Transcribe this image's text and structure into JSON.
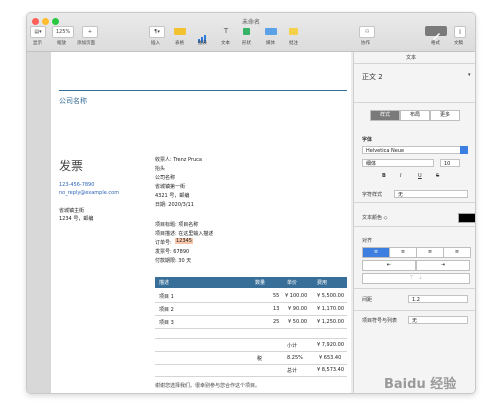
{
  "window": {
    "title": "未命名"
  },
  "toolbar": {
    "zoom_value": "125%",
    "labels": [
      "显示",
      "缩放",
      "添加页面",
      "插入",
      "表格",
      "图表",
      "文本",
      "形状",
      "媒体",
      "批注",
      "协作",
      "格式",
      "文稿"
    ]
  },
  "document": {
    "company_name": "公司名称",
    "heading": "发票",
    "phone": "123-456-7890",
    "email": "no_reply@example.com",
    "address_lines": [
      "省城镇主街",
      "1234 号，邮编"
    ],
    "recipient": [
      "收票人: Trenz Pruca",
      "抬头",
      "公司名称",
      "省城镇第一街",
      "4321 号，邮编",
      "日期: 2020/3/11"
    ],
    "project": [
      "项目标题: 项目名称",
      "项目描述: 在这里输入描述"
    ],
    "order_label": "订单号:",
    "order_number": "12345",
    "invoice_number": "发票号: 67890",
    "due": "付款期限: 30 天",
    "table_headers": [
      "描述",
      "数量",
      "单价",
      "费用"
    ],
    "rows": [
      {
        "desc": "项目 1",
        "qty": "55",
        "price": "¥ 100.00",
        "cost": "¥ 5,500.00"
      },
      {
        "desc": "项目 2",
        "qty": "13",
        "price": "¥ 90.00",
        "cost": "¥ 1,170.00"
      },
      {
        "desc": "项目 3",
        "qty": "25",
        "price": "¥ 50.00",
        "cost": "¥ 1,250.00"
      }
    ],
    "subtotal_label": "小计",
    "subtotal": "¥ 7,920.00",
    "tax_label": "税",
    "tax_rate": "8.25%",
    "tax": "¥ 653.40",
    "total_label": "总计",
    "total": "¥ 8,573.40",
    "footer": "谢谢您选择我们。很幸别参与您合作这个项目。"
  },
  "panel": {
    "header": "文本",
    "style_name": "正文 2",
    "tabs": [
      "样式",
      "布局",
      "更多"
    ],
    "font_section": "字体",
    "font_name": "Helvetica Neue",
    "font_style": "细体",
    "font_size": "10",
    "bold": "B",
    "italic": "I",
    "underline": "U",
    "strike": "S",
    "char_style_label": "字符样式",
    "char_style_value": "无",
    "text_color_label": "文本颜色 ◇",
    "align_label": "对齐",
    "spacing_label": "间距",
    "spacing_value": "1.2",
    "bullets_label": "项目符号与列表",
    "bullets_value": "无"
  },
  "colors": {
    "accent": "#386f99",
    "highlight": "#f6c5a8",
    "link": "#2c63b7"
  },
  "watermark": "Baidu 经验"
}
